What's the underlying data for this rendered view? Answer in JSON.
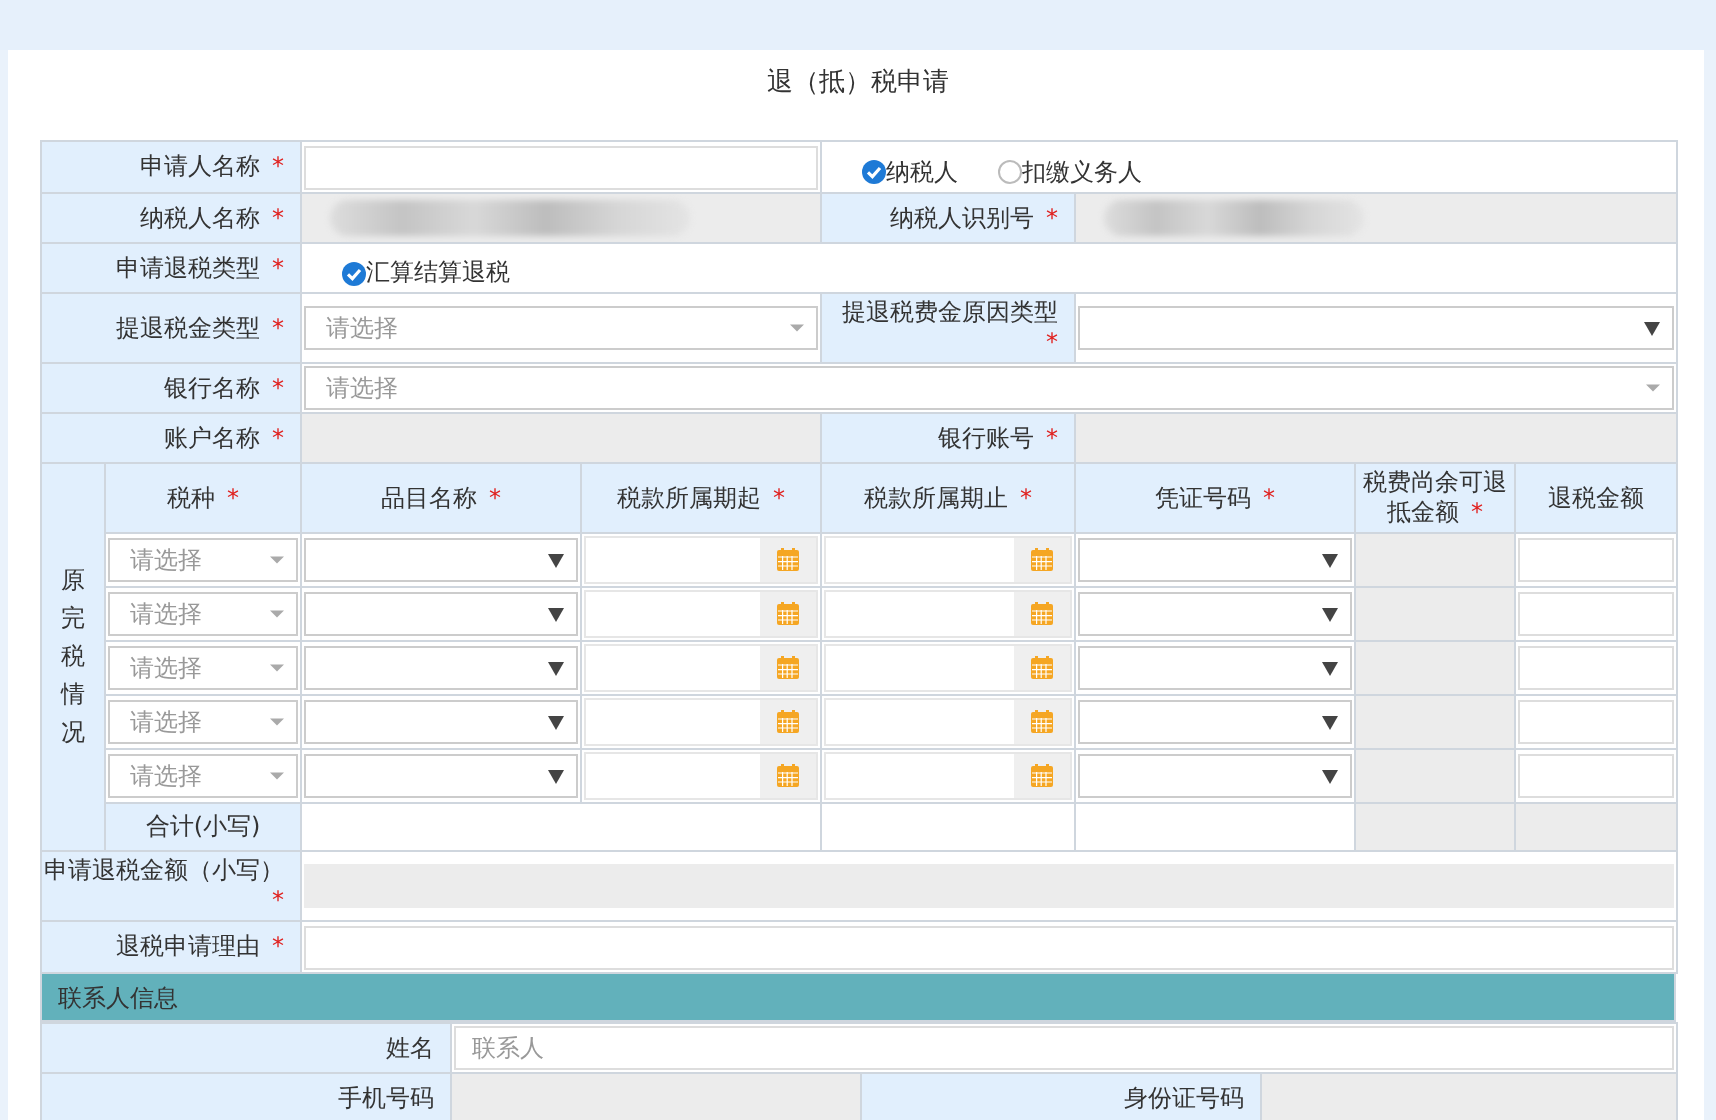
{
  "title": "退（抵）税申请",
  "required_mark": "*",
  "applicant": {
    "label": "申请人名称",
    "required": true,
    "options": [
      {
        "label": "纳税人",
        "selected": true
      },
      {
        "label": "扣缴义务人",
        "selected": false
      }
    ]
  },
  "taxpayer_name": {
    "label": "纳税人名称",
    "required": true
  },
  "taxpayer_id": {
    "label": "纳税人识别号",
    "required": true
  },
  "refund_type": {
    "label": "申请退税类型",
    "required": true,
    "options": [
      {
        "label": "汇算结算退税",
        "checked": true
      }
    ]
  },
  "refund_category": {
    "label": "提退税金类型",
    "required": true,
    "placeholder": "请选择"
  },
  "reason_type": {
    "label": "提退税费金原因类型",
    "required": true
  },
  "bank": {
    "label": "银行名称",
    "required": true,
    "placeholder": "请选择"
  },
  "account_name": {
    "label": "账户名称",
    "required": true
  },
  "bank_account": {
    "label": "银行账号",
    "required": true
  },
  "original_tax": {
    "label": "原完税情况",
    "columns": [
      {
        "label": "税种",
        "required": true
      },
      {
        "label": "品目名称",
        "required": true
      },
      {
        "label": "税款所属期起",
        "required": true
      },
      {
        "label": "税款所属期止",
        "required": true
      },
      {
        "label": "凭证号码",
        "required": true
      },
      {
        "label": "税费尚余可退抵金额",
        "required": true
      },
      {
        "label": "退税金额",
        "required": false
      }
    ],
    "rows": [
      {
        "placeholder": "请选择"
      },
      {
        "placeholder": "请选择"
      },
      {
        "placeholder": "请选择"
      },
      {
        "placeholder": "请选择"
      },
      {
        "placeholder": "请选择"
      }
    ],
    "total_label": "合计(小写)"
  },
  "refund_amount": {
    "label": "申请退税金额（小写）",
    "required": true
  },
  "refund_reason": {
    "label": "退税申请理由",
    "required": true
  },
  "contact": {
    "title": "联系人信息",
    "name_label": "姓名",
    "name_placeholder": "联系人",
    "phone_label": "手机号码",
    "id_label": "身份证号码"
  }
}
